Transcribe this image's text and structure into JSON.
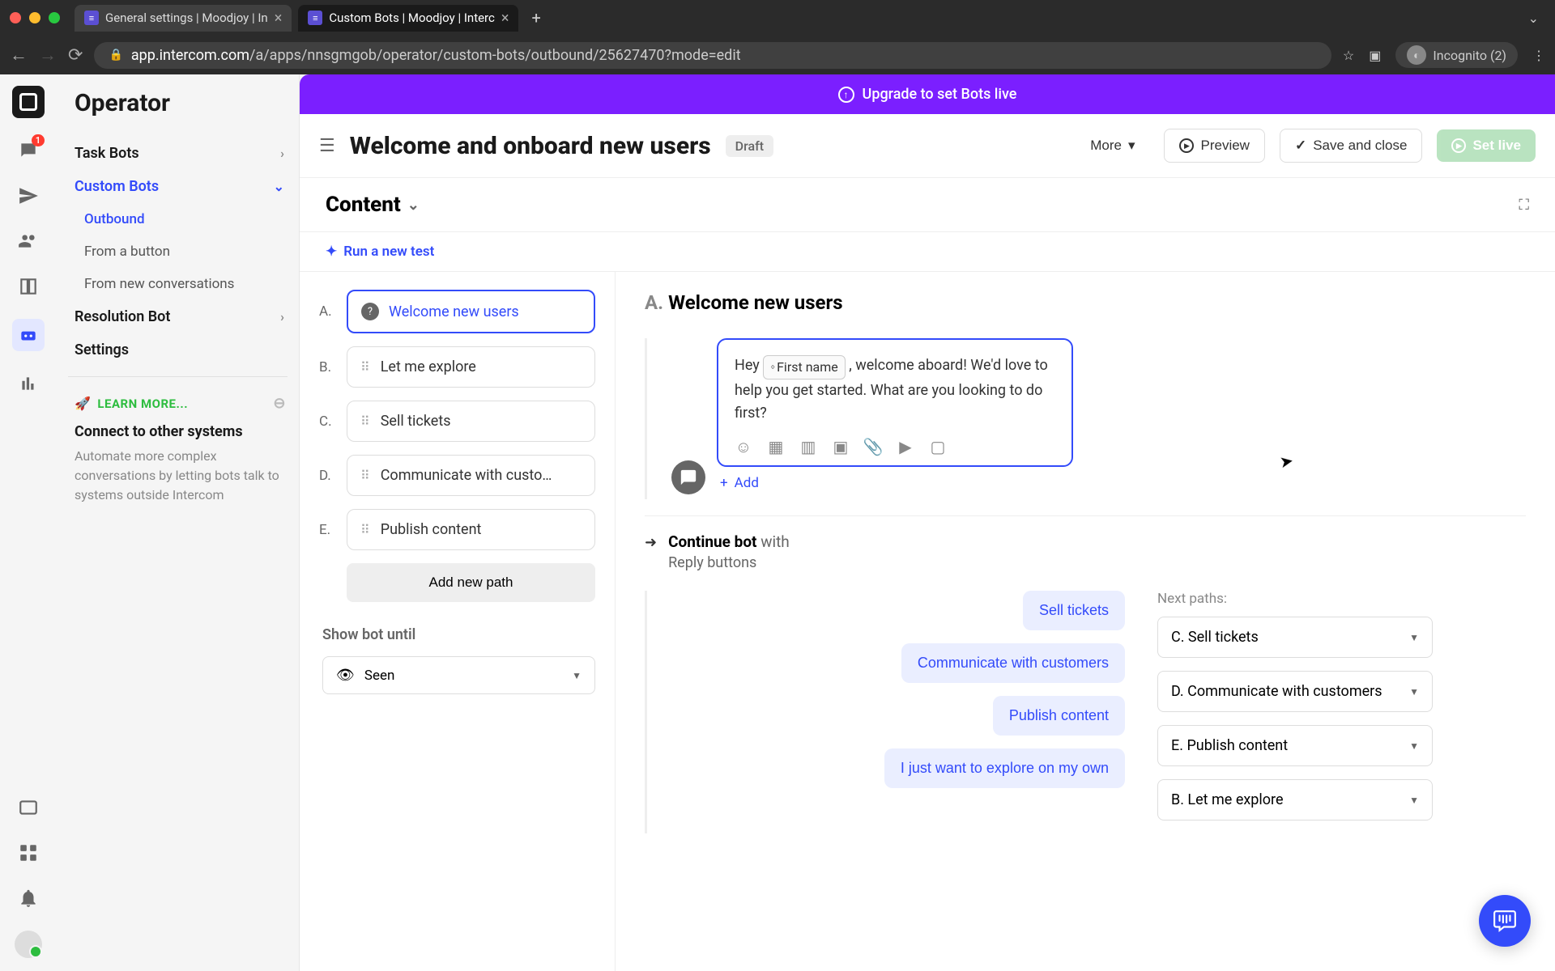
{
  "browser": {
    "tabs": [
      {
        "title": "General settings | Moodjoy | In"
      },
      {
        "title": "Custom Bots | Moodjoy | Interc"
      }
    ],
    "url_pre": "app.intercom.com",
    "url_post": "/a/apps/nnsgmgob/operator/custom-bots/outbound/25627470?mode=edit",
    "incognito": "Incognito (2)"
  },
  "rail": {
    "inbox_badge": "1"
  },
  "sidebar": {
    "title": "Operator",
    "task_bots": "Task Bots",
    "custom_bots": "Custom Bots",
    "outbound": "Outbound",
    "from_button": "From a button",
    "from_new_conv": "From new conversations",
    "resolution_bot": "Resolution Bot",
    "settings": "Settings",
    "learn_hdr": "LEARN MORE...",
    "learn_title": "Connect to other systems",
    "learn_desc": "Automate more complex conversations by letting bots talk to systems outside Intercom"
  },
  "banner": {
    "text": "Upgrade to set Bots live"
  },
  "header": {
    "title": "Welcome and onboard new users",
    "draft": "Draft",
    "more": "More",
    "preview": "Preview",
    "save_close": "Save and close",
    "set_live": "Set live"
  },
  "section": {
    "content": "Content",
    "run_test": "Run a new test"
  },
  "paths": {
    "a": {
      "letter": "A.",
      "label": "Welcome new users"
    },
    "b": {
      "letter": "B.",
      "label": "Let me explore"
    },
    "c": {
      "letter": "C.",
      "label": "Sell tickets"
    },
    "d": {
      "letter": "D.",
      "label": "Communicate with custo…"
    },
    "e": {
      "letter": "E.",
      "label": "Publish content"
    },
    "add_new": "Add new path",
    "show_until_label": "Show bot until",
    "show_until_value": "Seen"
  },
  "canvas": {
    "title_letter": "A.",
    "title": "Welcome new users",
    "msg_pre": "Hey ",
    "msg_var": "First name",
    "msg_post": " , welcome aboard! We'd love to help you get started. What are you looking to do first?",
    "add": "Add",
    "continue_strong": "Continue bot",
    "continue_with": " with",
    "continue_sub": "Reply buttons"
  },
  "replies": {
    "next_paths_label": "Next paths:",
    "r1": {
      "btn": "Sell tickets",
      "path": "C. Sell tickets"
    },
    "r2": {
      "btn": "Communicate with customers",
      "path": "D. Communicate with customers"
    },
    "r3": {
      "btn": "Publish content",
      "path": "E. Publish content"
    },
    "r4": {
      "btn": "I just want to explore on my own",
      "path": "B. Let me explore"
    }
  }
}
